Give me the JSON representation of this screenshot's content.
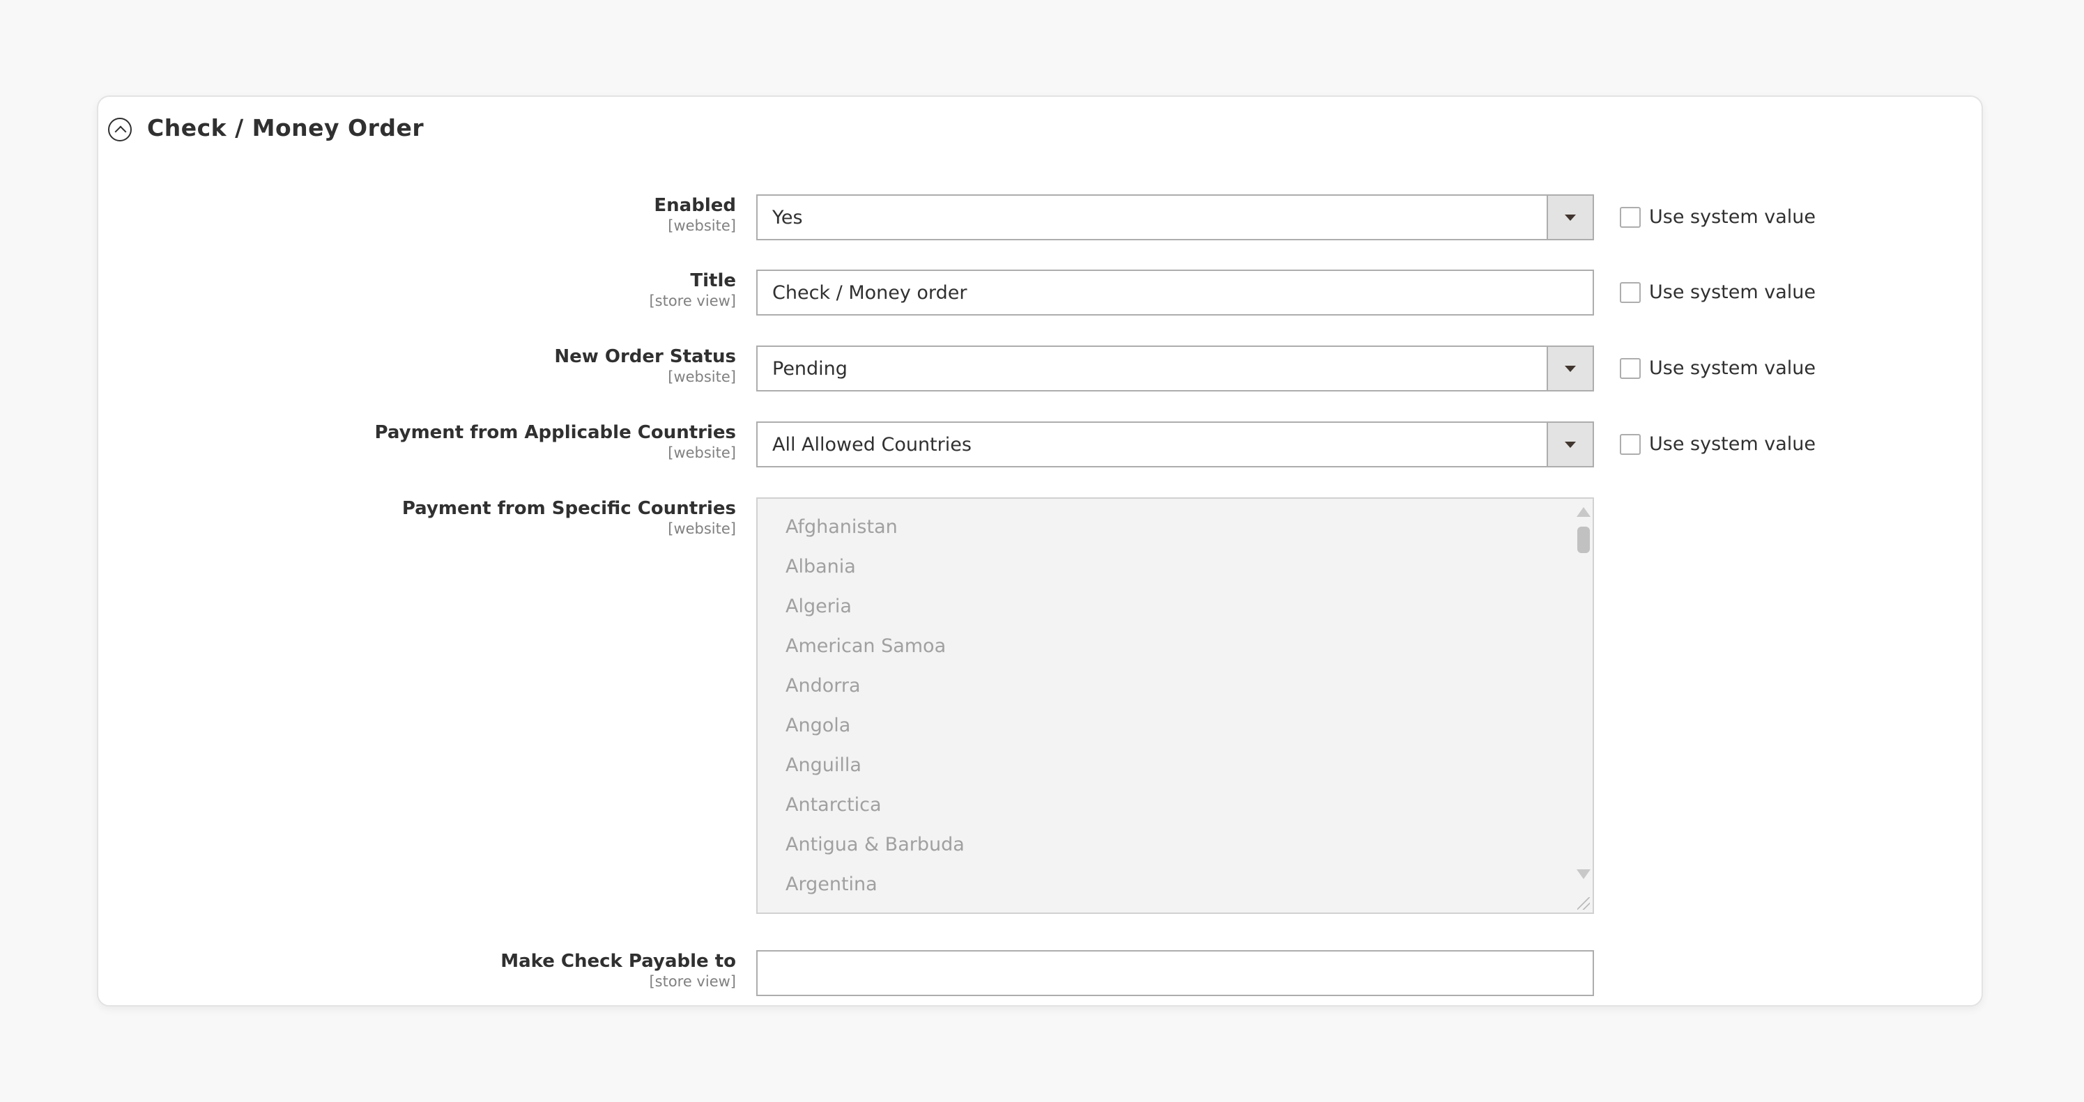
{
  "section": {
    "title": "Check / Money Order"
  },
  "fields": {
    "enabled": {
      "label": "Enabled",
      "scope": "[website]",
      "value": "Yes",
      "use_system_label": "Use system value"
    },
    "title": {
      "label": "Title",
      "scope": "[store view]",
      "value": "Check / Money order",
      "use_system_label": "Use system value"
    },
    "new_order_status": {
      "label": "New Order Status",
      "scope": "[website]",
      "value": "Pending",
      "use_system_label": "Use system value"
    },
    "applicable_countries": {
      "label": "Payment from Applicable Countries",
      "scope": "[website]",
      "value": "All Allowed Countries",
      "use_system_label": "Use system value"
    },
    "specific_countries": {
      "label": "Payment from Specific Countries",
      "scope": "[website]",
      "options": [
        "Afghanistan",
        "Albania",
        "Algeria",
        "American Samoa",
        "Andorra",
        "Angola",
        "Anguilla",
        "Antarctica",
        "Antigua & Barbuda",
        "Argentina"
      ]
    },
    "payable_to": {
      "label": "Make Check Payable to",
      "scope": "[store view]",
      "value": ""
    }
  }
}
